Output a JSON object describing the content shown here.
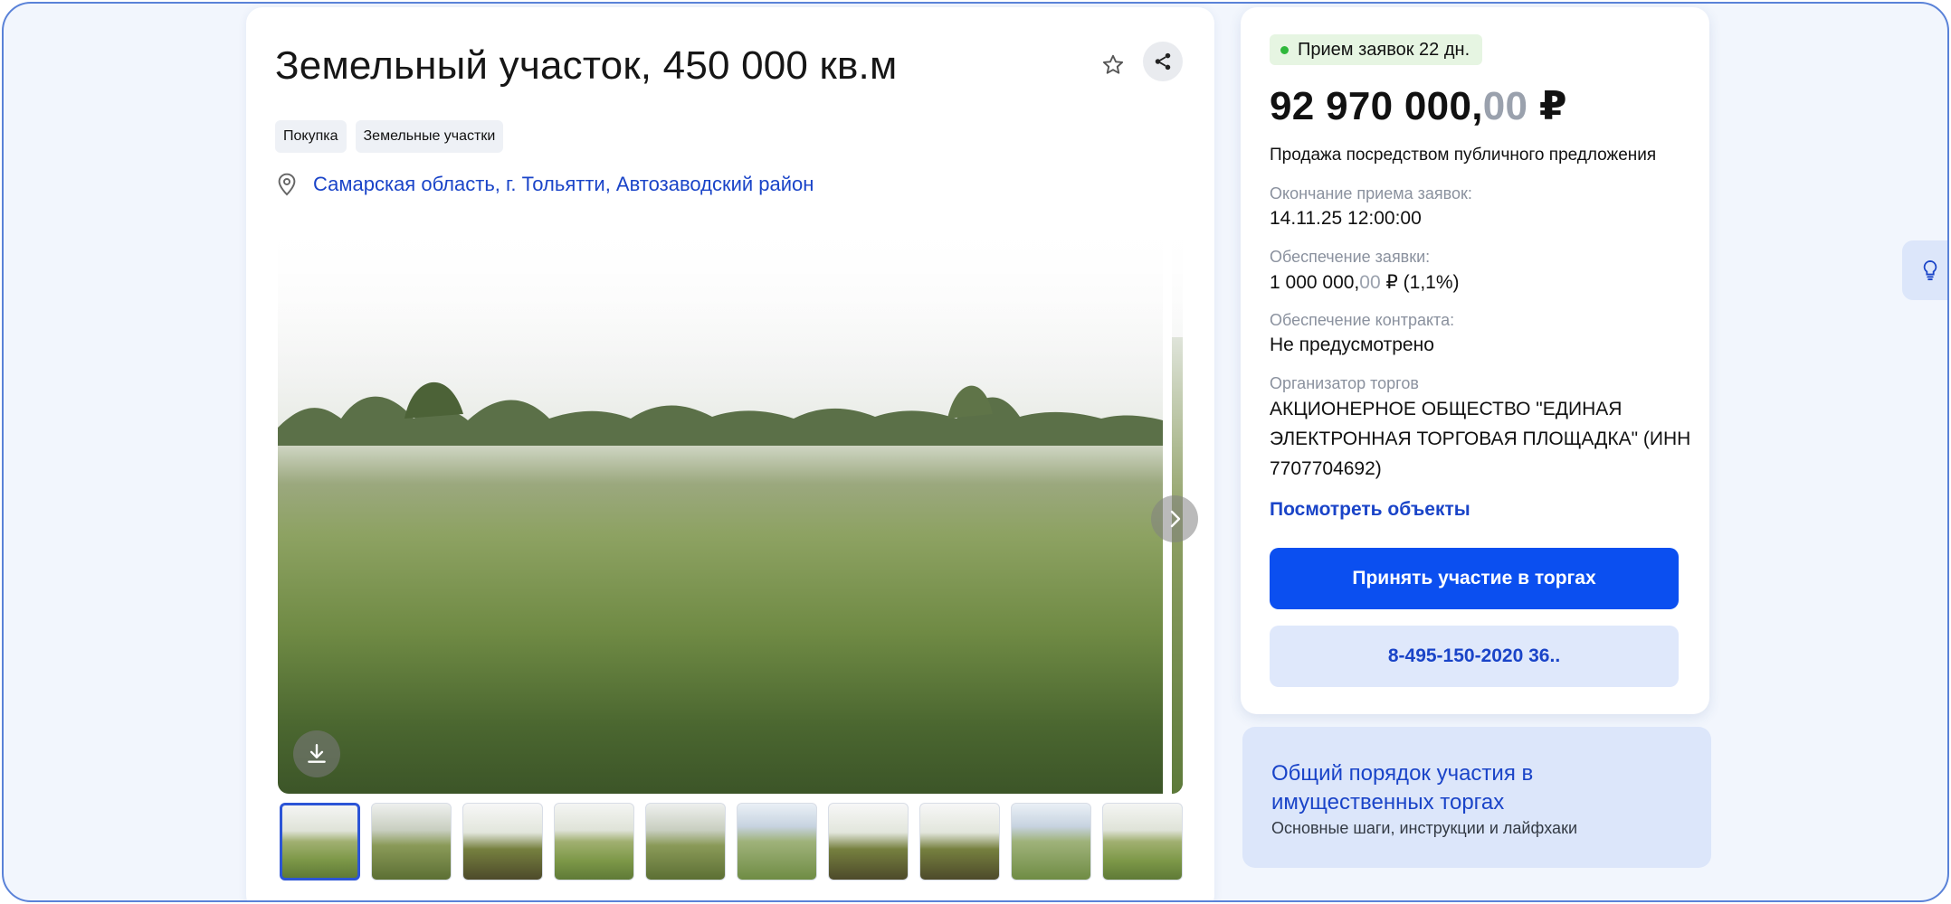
{
  "listing": {
    "title": "Земельный участок, 450 000 кв.м",
    "tags": [
      "Покупка",
      "Земельные участки"
    ],
    "location": "Самарская область, г. Тольятти, Автозаводский район"
  },
  "gallery": {
    "thumbnail_count": 10,
    "active_index": 0
  },
  "sidebar": {
    "status": "Прием заявок 22 дн.",
    "price_main": "92 970 000,",
    "price_cents": "00",
    "price_currency": " ₽",
    "sale_type": "Продажа посредством публичного предложения",
    "deadline_label": "Окончание приема заявок:",
    "deadline_value": "14.11.25 12:00:00",
    "deposit_label": "Обеспечение заявки:",
    "deposit_main": "1 000 000,",
    "deposit_cents": "00",
    "deposit_suffix": " ₽ (1,1%)",
    "contract_label": "Обеспечение контракта:",
    "contract_value": "Не предусмотрено",
    "organizer_label": "Организатор торгов",
    "organizer_value": "АКЦИОНЕРНОЕ ОБЩЕСТВО \"ЕДИНАЯ ЭЛЕКТРОННАЯ ТОРГОВАЯ ПЛОЩАДКА\" (ИНН 7707704692)",
    "view_objects": "Посмотреть объекты",
    "participate_button": "Принять участие в торгах",
    "phone_button": "8-495-150-2020 36.."
  },
  "info_card": {
    "title": "Общий порядок участия в имущественных торгах",
    "subtitle": "Основные шаги, инструкции и лайфхаки"
  },
  "colors": {
    "accent": "#0b4ff0",
    "link": "#1a44c8",
    "status_dot": "#2fb83c"
  }
}
